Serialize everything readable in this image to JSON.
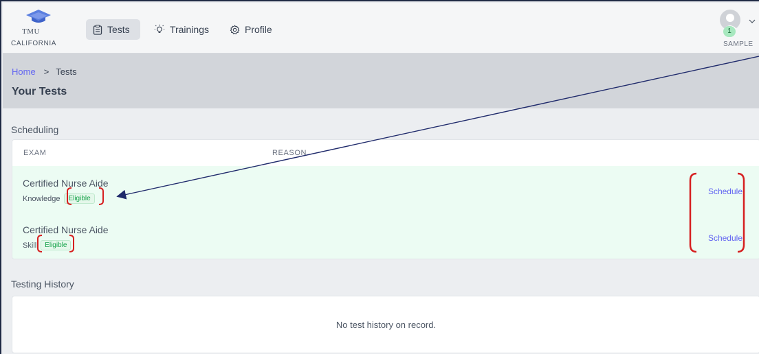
{
  "brand": {
    "name_top": "TMU",
    "name_bottom": "CALIFORNIA"
  },
  "nav": {
    "tests": "Tests",
    "trainings": "Trainings",
    "profile": "Profile"
  },
  "user": {
    "name": "SAMPLE",
    "badge": "1"
  },
  "breadcrumb": {
    "home": "Home",
    "separator": ">",
    "current": "Tests"
  },
  "page_title": "Your Tests",
  "scheduling": {
    "title": "Scheduling",
    "columns": {
      "exam": "EXAM",
      "reason": "REASON"
    },
    "rows": [
      {
        "exam": "Certified Nurse Aide",
        "type": "Knowledge",
        "status": "Eligible",
        "action": "Schedule"
      },
      {
        "exam": "Certified Nurse Aide",
        "type": "Skill",
        "status": "Eligible",
        "action": "Schedule"
      }
    ]
  },
  "history": {
    "title": "Testing History",
    "empty": "No test history on record."
  },
  "colors": {
    "accent": "#6366f1",
    "eligible_row_bg": "#ecfcf3",
    "eligible_text": "#16a34a",
    "annotation_red": "#d61f1f",
    "annotation_arrow": "#1f2a6b"
  }
}
